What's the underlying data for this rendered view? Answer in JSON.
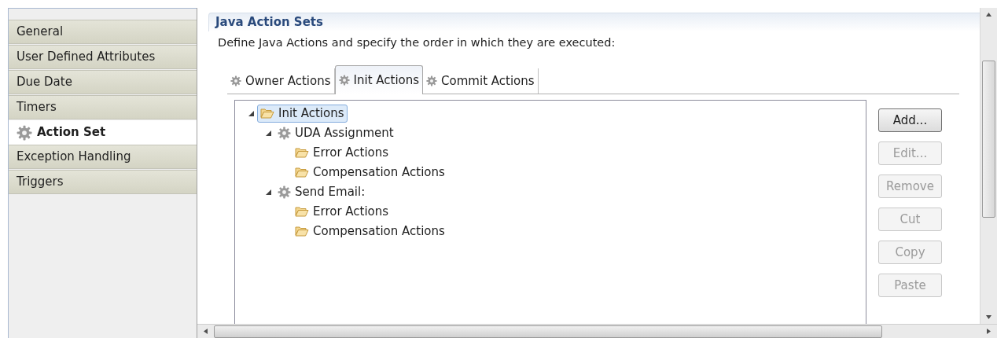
{
  "sidebar": {
    "items": [
      {
        "label": "General",
        "selected": false
      },
      {
        "label": "User Defined Attributes",
        "selected": false
      },
      {
        "label": "Due Date",
        "selected": false
      },
      {
        "label": "Timers",
        "selected": false
      },
      {
        "label": "Action Set",
        "selected": true
      },
      {
        "label": "Exception Handling",
        "selected": false
      },
      {
        "label": "Triggers",
        "selected": false
      }
    ]
  },
  "section": {
    "title": "Java Action Sets",
    "description": "Define Java Actions and specify the order in which they are executed:"
  },
  "tabs": [
    {
      "label": "Owner Actions",
      "selected": false
    },
    {
      "label": "Init Actions",
      "selected": true
    },
    {
      "label": "Commit Actions",
      "selected": false
    }
  ],
  "tree": [
    {
      "label": "Init Actions",
      "kind": "folder",
      "expanded": true,
      "selected": true,
      "children": [
        {
          "label": "UDA Assignment",
          "kind": "action",
          "expanded": true,
          "selected": false,
          "children": [
            {
              "label": "Error Actions",
              "kind": "folder",
              "selected": false
            },
            {
              "label": "Compensation Actions",
              "kind": "folder",
              "selected": false
            }
          ]
        },
        {
          "label": "Send Email:",
          "kind": "action",
          "expanded": true,
          "selected": false,
          "children": [
            {
              "label": "Error Actions",
              "kind": "folder",
              "selected": false
            },
            {
              "label": "Compensation Actions",
              "kind": "folder",
              "selected": false
            }
          ]
        }
      ]
    }
  ],
  "buttons": [
    {
      "label": "Add...",
      "disabled": false
    },
    {
      "label": "Edit...",
      "disabled": true
    },
    {
      "label": "Remove",
      "disabled": true
    },
    {
      "label": "Cut",
      "disabled": true
    },
    {
      "label": "Copy",
      "disabled": true
    },
    {
      "label": "Paste",
      "disabled": true
    }
  ]
}
